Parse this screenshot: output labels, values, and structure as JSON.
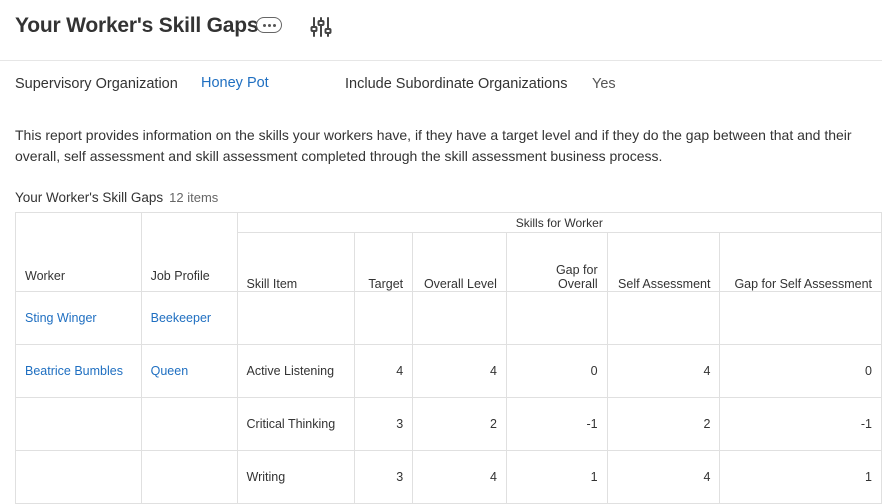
{
  "page": {
    "title": "Your Worker's Skill Gaps"
  },
  "prompts": {
    "supervisory_org_label": "Supervisory Organization",
    "supervisory_org_value": "Honey Pot",
    "include_sub_label": "Include Subordinate Organizations",
    "include_sub_value": "Yes"
  },
  "description": "This report provides information on the skills your workers have, if they have a target level and if they do the gap between that and their overall, self assessment and skill assessment completed through the skill assessment business process.",
  "grid": {
    "title": "Your Worker's Skill Gaps",
    "count": "12 items",
    "group_header": "Skills for Worker",
    "columns": [
      "Worker",
      "Job Profile",
      "Skill Item",
      "Target",
      "Overall Level",
      "Gap for Overall",
      "Self Assessment",
      "Gap for Self Assessment"
    ],
    "rows": [
      {
        "worker": "Sting Winger",
        "job_profile": "Beekeeper",
        "skill": "",
        "target": "",
        "overall": "",
        "gap_overall": "",
        "self": "",
        "gap_self": ""
      },
      {
        "worker": "Beatrice Bumbles",
        "job_profile": "Queen",
        "skill": "Active Listening",
        "target": "4",
        "overall": "4",
        "gap_overall": "0",
        "self": "4",
        "gap_self": "0"
      },
      {
        "worker": "",
        "job_profile": "",
        "skill": "Critical Thinking",
        "target": "3",
        "overall": "2",
        "gap_overall": "-1",
        "self": "2",
        "gap_self": "-1"
      },
      {
        "worker": "",
        "job_profile": "",
        "skill": "Writing",
        "target": "3",
        "overall": "4",
        "gap_overall": "1",
        "self": "4",
        "gap_self": "1"
      }
    ]
  },
  "icons": {
    "more": "more-icon",
    "filter": "related-actions-filter-icon"
  },
  "colors": {
    "link": "#1f6fc1",
    "text": "#333333",
    "border": "#e0e0e0"
  }
}
